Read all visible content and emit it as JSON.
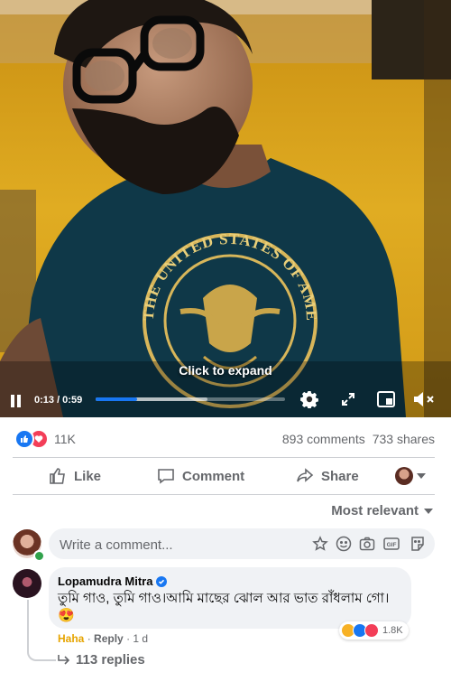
{
  "video": {
    "overlay_label": "Click to expand",
    "time_display": "0:13 / 0:59",
    "progress": {
      "played_fraction": 0.22,
      "buffered_fraction": 0.59
    },
    "shirt_text": "THE UNITED STATES OF AMERICA",
    "colors": {
      "progress_played": "#1877f2",
      "wall": "#d9a31a",
      "shirt": "#0f3848"
    }
  },
  "reactions": {
    "types": [
      "like",
      "love"
    ],
    "count": "11K"
  },
  "stats": {
    "comments": "893 comments",
    "shares": "733 shares"
  },
  "actions": {
    "like_label": "Like",
    "comment_label": "Comment",
    "share_label": "Share"
  },
  "sort": {
    "label": "Most relevant"
  },
  "composer": {
    "placeholder": "Write a comment...",
    "icons": [
      "sticker-icon",
      "emoji-icon",
      "camera-icon",
      "gif-icon",
      "avatar-sticker-icon"
    ]
  },
  "comment": {
    "author": "Lopamudra Mitra",
    "verified": true,
    "text": "তুমি গাও, তুমি গাও।আমি মাছের ঝোল আর ভাত রাঁধলাম গো। 😍",
    "reaction_count": "1.8K",
    "reaction_types": [
      "haha",
      "like",
      "love"
    ],
    "my_reaction": "Haha",
    "reply_label": "Reply",
    "separator": "·",
    "time_ago": "1 d",
    "replies_label": "113 replies"
  },
  "colors": {
    "brand_blue": "#1877f2",
    "love_red": "#f33e58",
    "haha_yellow": "#f7b125",
    "secondary_text": "#65676b",
    "input_bg": "#f0f2f5"
  }
}
